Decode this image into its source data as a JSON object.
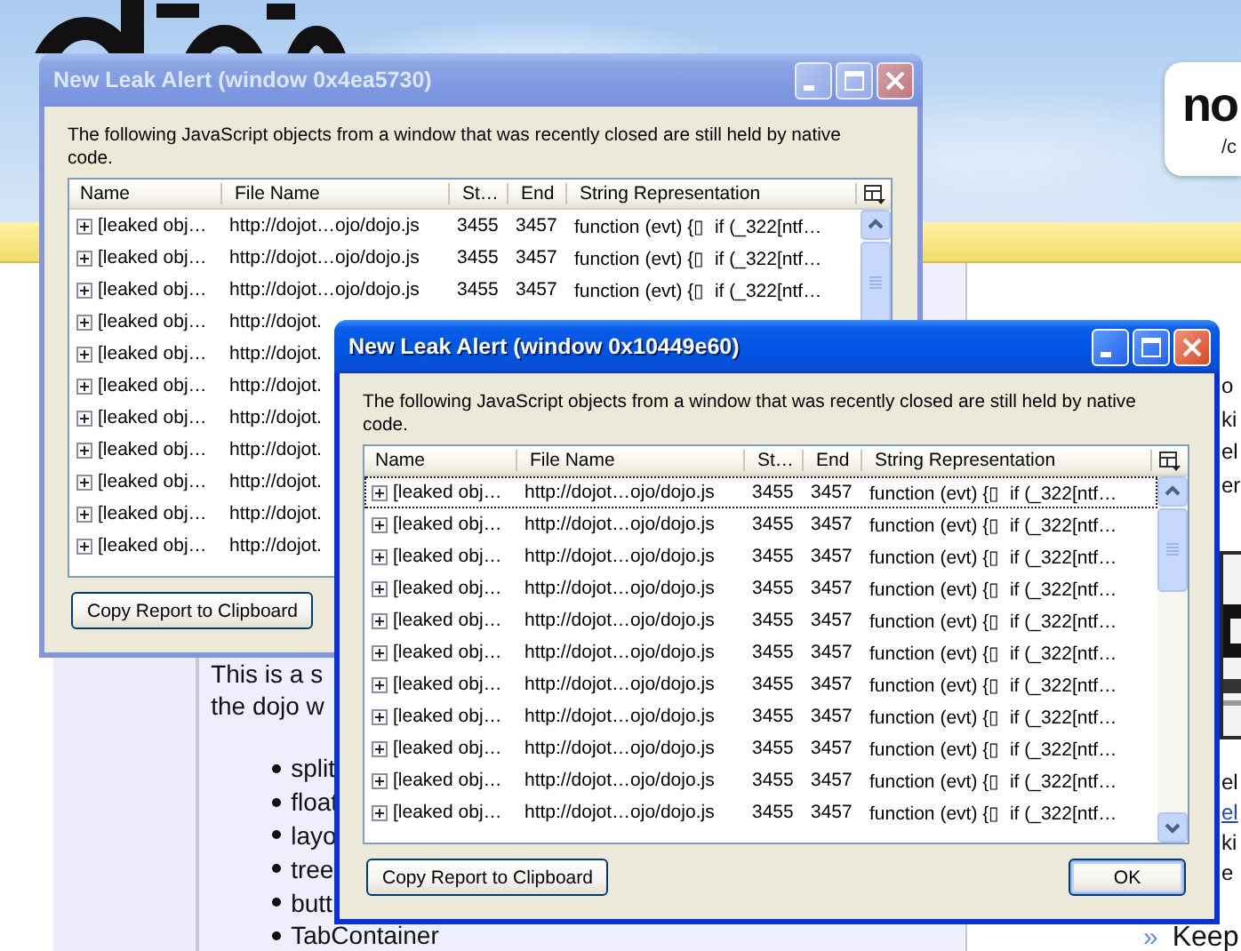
{
  "page": {
    "badge": {
      "title": "no",
      "subtitle": "/c"
    },
    "main": {
      "intro_lines": [
        "This is a s",
        "the dojo w"
      ],
      "list_items": [
        "split",
        "float",
        "layo",
        "tree",
        "butt",
        "TabContainer"
      ]
    },
    "right_column": {
      "lines_top": [
        "o",
        "ki",
        "el",
        "er"
      ],
      "picture": {
        "kind": "picture"
      },
      "lines_bottom": [
        {
          "text": "el",
          "kind": "text"
        },
        {
          "text": "el",
          "kind": "link"
        },
        {
          "text": "ki",
          "kind": "text"
        },
        {
          "text": "e",
          "kind": "text"
        }
      ],
      "more_link": {
        "marker": "»",
        "text": "Keep"
      }
    }
  },
  "windows": [
    {
      "title": "New Leak Alert (window 0x4ea5730)",
      "active": false,
      "description": "The following JavaScript objects from a window that was recently closed are still held by native code.",
      "columns": [
        "Name",
        "File Name",
        "St…",
        "End",
        "String Representation"
      ],
      "rows": [
        {
          "focused": false,
          "cells": [
            "[leaked obj…",
            "http://dojot…ojo/dojo.js",
            "3455",
            "3457",
            "function (evt) {▯  if (_322[ntf…"
          ]
        },
        {
          "focused": false,
          "cells": [
            "[leaked obj…",
            "http://dojot…ojo/dojo.js",
            "3455",
            "3457",
            "function (evt) {▯  if (_322[ntf…"
          ]
        },
        {
          "focused": false,
          "cells": [
            "[leaked obj…",
            "http://dojot…ojo/dojo.js",
            "3455",
            "3457",
            "function (evt) {▯  if (_322[ntf…"
          ]
        },
        {
          "focused": false,
          "cells": [
            "[leaked obj…",
            "http://dojot."
          ]
        },
        {
          "focused": false,
          "cells": [
            "[leaked obj…",
            "http://dojot."
          ]
        },
        {
          "focused": false,
          "cells": [
            "[leaked obj…",
            "http://dojot."
          ]
        },
        {
          "focused": false,
          "cells": [
            "[leaked obj…",
            "http://dojot."
          ]
        },
        {
          "focused": false,
          "cells": [
            "[leaked obj…",
            "http://dojot."
          ]
        },
        {
          "focused": false,
          "cells": [
            "[leaked obj…",
            "http://dojot."
          ]
        },
        {
          "focused": false,
          "cells": [
            "[leaked obj…",
            "http://dojot."
          ]
        },
        {
          "focused": false,
          "cells": [
            "[leaked obj…",
            "http://dojot."
          ]
        }
      ],
      "buttons": [
        {
          "label": "Copy Report to Clipboard",
          "default": false
        }
      ]
    },
    {
      "title": "New Leak Alert (window 0x10449e60)",
      "active": true,
      "description": "The following JavaScript objects from a window that was recently closed are still held by native code.",
      "columns": [
        "Name",
        "File Name",
        "St…",
        "End",
        "String Representation"
      ],
      "rows": [
        {
          "focused": true,
          "cells": [
            "[leaked obj…",
            "http://dojot…ojo/dojo.js",
            "3455",
            "3457",
            "function (evt) {▯  if (_322[ntf…"
          ]
        },
        {
          "focused": false,
          "cells": [
            "[leaked obj…",
            "http://dojot…ojo/dojo.js",
            "3455",
            "3457",
            "function (evt) {▯  if (_322[ntf…"
          ]
        },
        {
          "focused": false,
          "cells": [
            "[leaked obj…",
            "http://dojot…ojo/dojo.js",
            "3455",
            "3457",
            "function (evt) {▯  if (_322[ntf…"
          ]
        },
        {
          "focused": false,
          "cells": [
            "[leaked obj…",
            "http://dojot…ojo/dojo.js",
            "3455",
            "3457",
            "function (evt) {▯  if (_322[ntf…"
          ]
        },
        {
          "focused": false,
          "cells": [
            "[leaked obj…",
            "http://dojot…ojo/dojo.js",
            "3455",
            "3457",
            "function (evt) {▯  if (_322[ntf…"
          ]
        },
        {
          "focused": false,
          "cells": [
            "[leaked obj…",
            "http://dojot…ojo/dojo.js",
            "3455",
            "3457",
            "function (evt) {▯  if (_322[ntf…"
          ]
        },
        {
          "focused": false,
          "cells": [
            "[leaked obj…",
            "http://dojot…ojo/dojo.js",
            "3455",
            "3457",
            "function (evt) {▯  if (_322[ntf…"
          ]
        },
        {
          "focused": false,
          "cells": [
            "[leaked obj…",
            "http://dojot…ojo/dojo.js",
            "3455",
            "3457",
            "function (evt) {▯  if (_322[ntf…"
          ]
        },
        {
          "focused": false,
          "cells": [
            "[leaked obj…",
            "http://dojot…ojo/dojo.js",
            "3455",
            "3457",
            "function (evt) {▯  if (_322[ntf…"
          ]
        },
        {
          "focused": false,
          "cells": [
            "[leaked obj…",
            "http://dojot…ojo/dojo.js",
            "3455",
            "3457",
            "function (evt) {▯  if (_322[ntf…"
          ]
        },
        {
          "focused": false,
          "cells": [
            "[leaked obj…",
            "http://dojot…ojo/dojo.js",
            "3455",
            "3457",
            "function (evt) {▯  if (_322[ntf…"
          ]
        }
      ],
      "buttons": [
        {
          "label": "Copy Report to Clipboard",
          "default": false
        },
        {
          "label": "OK",
          "default": true
        }
      ]
    }
  ]
}
